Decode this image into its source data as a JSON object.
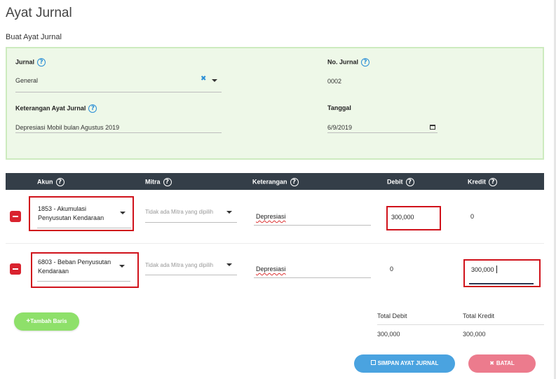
{
  "page": {
    "title": "Ayat Jurnal",
    "section_title": "Buat Ayat Jurnal"
  },
  "form": {
    "jurnal_label": "Jurnal",
    "jurnal_value": "General",
    "no_jurnal_label": "No. Jurnal",
    "no_jurnal_value": "0002",
    "keterangan_label": "Keterangan Ayat Jurnal",
    "keterangan_value": "Depresiasi Mobil bulan Agustus 2019",
    "tanggal_label": "Tanggal",
    "tanggal_value": "6/9/2019"
  },
  "table": {
    "headers": {
      "akun": "Akun",
      "mitra": "Mitra",
      "keterangan": "Keterangan",
      "debit": "Debit",
      "kredit": "Kredit"
    },
    "rows": [
      {
        "akun_line1": "1853 - Akumulasi",
        "akun_line2": "Penyusutan Kendaraan",
        "mitra": "Tidak ada Mitra yang dipilih",
        "keterangan": "Depresiasi",
        "debit": "300,000",
        "kredit": "0"
      },
      {
        "akun_line1": "6803 - Beban Penyusutan",
        "akun_line2": "Kendaraan",
        "mitra": "Tidak ada Mitra yang dipilih",
        "keterangan": "Depresiasi",
        "debit": "0",
        "kredit": "300,000"
      }
    ]
  },
  "totals": {
    "debit_label": "Total Debit",
    "kredit_label": "Total Kredit",
    "debit_value": "300,000",
    "kredit_value": "300,000"
  },
  "buttons": {
    "add_row": "Tambah Baris",
    "save": "SIMPAN AYAT JURNAL",
    "cancel": "BATAL"
  },
  "icons": {
    "help": "?",
    "clear": "✖",
    "plus": "+",
    "save": "floppy-icon",
    "close": "✖"
  },
  "colors": {
    "panel_bg": "#eef8e8",
    "header_bg": "#343e48",
    "accent_blue": "#4aa3e0",
    "accent_green": "#8ee06a",
    "accent_red": "#ec7b8d",
    "highlight_red": "#d0121b"
  }
}
